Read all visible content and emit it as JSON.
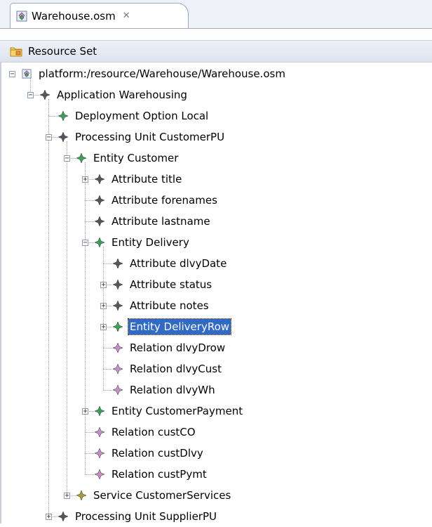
{
  "editor_tab": {
    "title": "Warehouse.osm",
    "close_glyph": "✕",
    "icon": "model-file-icon"
  },
  "header": {
    "title": "Resource Set",
    "icon": "resource-set-icon"
  },
  "colors": {
    "selection": "#316ac5",
    "entity_icon": "#3aa05a",
    "attribute_icon": "#55555f",
    "relation_icon": "#c58fc8",
    "service_icon": "#a89c3a"
  },
  "tree": [
    {
      "label": "platform:/resource/Warehouse/Warehouse.osm",
      "depth": 0,
      "expander": "minus",
      "kind": "resource"
    },
    {
      "label": "Application Warehousing",
      "depth": 1,
      "expander": "minus",
      "kind": "attribute"
    },
    {
      "label": "Deployment Option Local",
      "depth": 2,
      "expander": "none",
      "kind": "entity"
    },
    {
      "label": "Processing Unit CustomerPU",
      "depth": 2,
      "expander": "minus",
      "kind": "attribute"
    },
    {
      "label": "Entity Customer",
      "depth": 3,
      "expander": "minus",
      "kind": "entity"
    },
    {
      "label": "Attribute title",
      "depth": 4,
      "expander": "plus",
      "kind": "attribute"
    },
    {
      "label": "Attribute forenames",
      "depth": 4,
      "expander": "none",
      "kind": "attribute"
    },
    {
      "label": "Attribute lastname",
      "depth": 4,
      "expander": "none",
      "kind": "attribute"
    },
    {
      "label": "Entity Delivery",
      "depth": 4,
      "expander": "minus",
      "kind": "entity"
    },
    {
      "label": "Attribute dlvyDate",
      "depth": 5,
      "expander": "none",
      "kind": "attribute"
    },
    {
      "label": "Attribute status",
      "depth": 5,
      "expander": "plus",
      "kind": "attribute"
    },
    {
      "label": "Attribute notes",
      "depth": 5,
      "expander": "plus",
      "kind": "attribute"
    },
    {
      "label": "Entity DeliveryRow",
      "depth": 5,
      "expander": "plus",
      "kind": "entity",
      "selected": true
    },
    {
      "label": "Relation dlvyDrow",
      "depth": 5,
      "expander": "none",
      "kind": "relation"
    },
    {
      "label": "Relation dlvyCust",
      "depth": 5,
      "expander": "none",
      "kind": "relation"
    },
    {
      "label": "Relation dlvyWh",
      "depth": 5,
      "expander": "none",
      "kind": "relation"
    },
    {
      "label": "Entity CustomerPayment",
      "depth": 4,
      "expander": "plus",
      "kind": "entity"
    },
    {
      "label": "Relation custCO",
      "depth": 4,
      "expander": "none",
      "kind": "relation"
    },
    {
      "label": "Relation custDlvy",
      "depth": 4,
      "expander": "none",
      "kind": "relation"
    },
    {
      "label": "Relation custPymt",
      "depth": 4,
      "expander": "none",
      "kind": "relation"
    },
    {
      "label": "Service CustomerServices",
      "depth": 3,
      "expander": "plus",
      "kind": "service"
    },
    {
      "label": "Processing Unit SupplierPU",
      "depth": 2,
      "expander": "plus",
      "kind": "attribute"
    }
  ]
}
